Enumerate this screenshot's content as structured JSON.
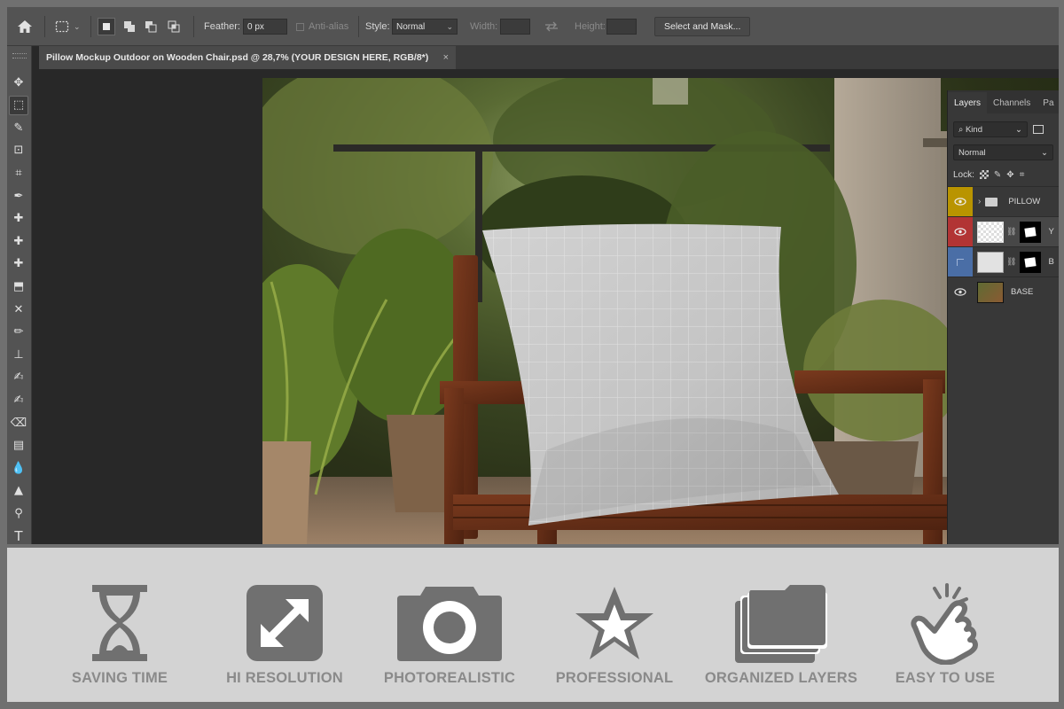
{
  "options_bar": {
    "feather_label": "Feather:",
    "feather_value": "0 px",
    "anti_alias_label": "Anti-alias",
    "style_label": "Style:",
    "style_value": "Normal",
    "width_label": "Width:",
    "height_label": "Height:",
    "select_and_mask_label": "Select and Mask..."
  },
  "document": {
    "tab_title": "Pillow Mockup Outdoor on Wooden Chair.psd @ 28,7% (YOUR DESIGN HERE, RGB/8*)",
    "close_glyph": "×"
  },
  "layers_panel": {
    "tabs": [
      "Layers",
      "Channels",
      "Pa"
    ],
    "filter_kind": "Kind",
    "blend_mode": "Normal",
    "lock_label": "Lock:",
    "layers": [
      {
        "name": "PILLOW",
        "type": "group",
        "color": "#b99400"
      },
      {
        "name": "Y",
        "type": "smart-object",
        "color": "#b23434"
      },
      {
        "name": "B",
        "type": "layer",
        "color": "#4a6ea6"
      },
      {
        "name": "BASE",
        "type": "image",
        "color": ""
      }
    ]
  },
  "features": [
    {
      "label": "SAVING TIME",
      "icon": "hourglass-icon"
    },
    {
      "label": "HI RESOLUTION",
      "icon": "expand-arrows-icon"
    },
    {
      "label": "PHOTOREALISTIC",
      "icon": "camera-icon"
    },
    {
      "label": "PROFESSIONAL",
      "icon": "star-icon"
    },
    {
      "label": "ORGANIZED LAYERS",
      "icon": "layers-folder-icon"
    },
    {
      "label": "EASY TO USE",
      "icon": "click-hand-icon"
    }
  ],
  "colors": {
    "feature_icon": "#707070",
    "feature_text": "#8a8a8a",
    "strip_background": "#d3d3d3"
  }
}
